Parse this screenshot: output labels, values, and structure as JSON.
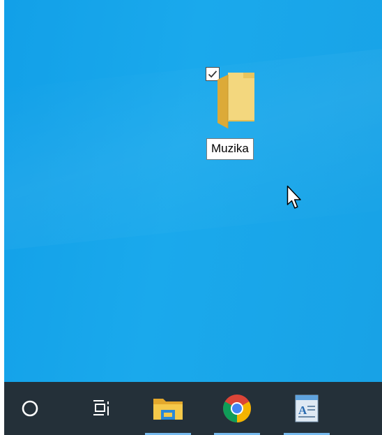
{
  "desktop": {
    "background_color": "#19a6ea",
    "icons": [
      {
        "label": "Muzika",
        "type": "folder",
        "icon": "folder-icon",
        "selected": true,
        "checkbox_checked": true
      }
    ]
  },
  "cursor": {
    "icon": "mouse-pointer-icon"
  },
  "taskbar": {
    "background_color": "#243039",
    "accent_color": "#76b9ed",
    "items": [
      {
        "id": "search",
        "icon": "cortana-search-icon"
      },
      {
        "id": "task-view",
        "icon": "task-view-icon"
      },
      {
        "id": "file-explorer",
        "icon": "file-explorer-icon",
        "running": true
      },
      {
        "id": "chrome",
        "icon": "chrome-icon",
        "running": true
      },
      {
        "id": "wordpad",
        "icon": "wordpad-icon",
        "running": true
      }
    ]
  }
}
